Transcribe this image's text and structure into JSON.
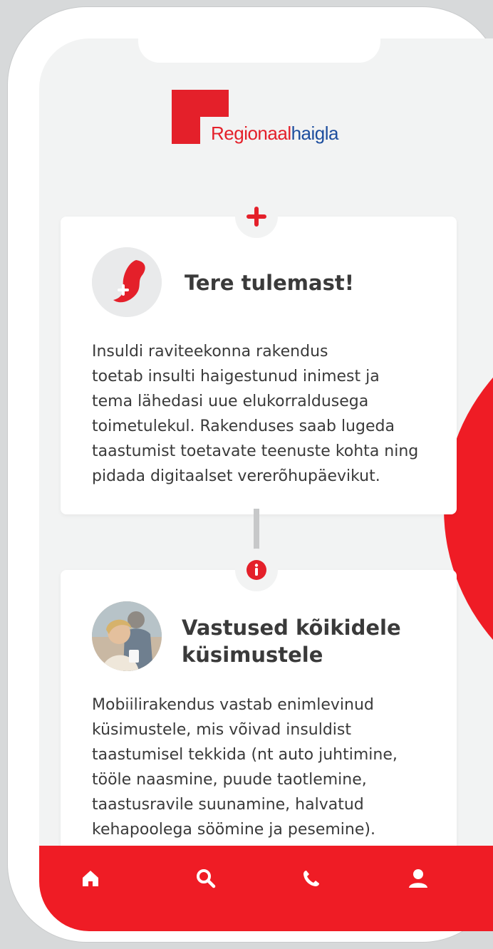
{
  "brand": {
    "name_part1": "Regionaal",
    "name_part2": "haigla",
    "red": "#e4202a",
    "blue": "#1d4e9e"
  },
  "cards": [
    {
      "badge_icon": "plus-icon",
      "icon": "stroke-logo-icon",
      "title": "Tere tulemast!",
      "body": "Insuldi raviteekonna rakendus\ntoetab insulti haigestunud inimest ja\ntema lähedasi uue elukorraldusega\ntoimetulekul. Rakenduses saab lugeda\ntaastumist toetavate teenuste kohta ning\npidada digitaalset vererõhupäevikut."
    },
    {
      "badge_icon": "info-icon",
      "icon": "people-photo",
      "title_line1": "Vastused kõikidele",
      "title_line2": "küsimustele",
      "body": "Mobiilirakendus vastab enimlevinud\nküsimustele, mis võivad insuldist\ntaastumisel tekkida (nt auto juhtimine,\ntööle naasmine, puude taotlemine,\ntaastusravile suunamine, halvatud\nkehapoolega söömine ja pesemine)."
    }
  ],
  "nav": {
    "items": [
      "home-icon",
      "search-icon",
      "phone-icon",
      "user-icon"
    ],
    "background": "#ef1c25"
  }
}
